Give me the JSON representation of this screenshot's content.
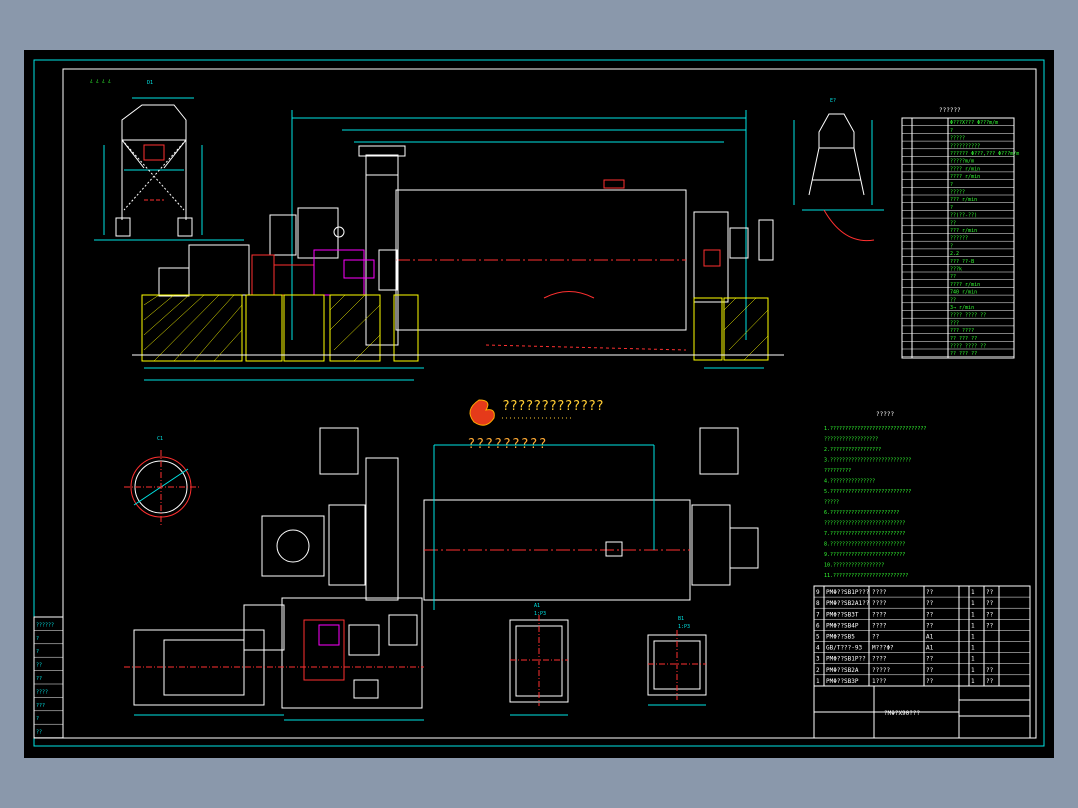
{
  "drawing": {
    "title_block_name": "?MΦ?X90???",
    "corner_marks": "¿ ¿ ¿ ¿",
    "logo_text": "?????????????",
    "watermark_text": "?????????",
    "spec_table_title": "??????",
    "notes_title": "?????",
    "notes_lines": [
      "1.????????????????????????????????",
      "  ??????????????????",
      "2.?????????????????",
      "3.???????????????????????????",
      "  ?????????",
      "4.???????????????",
      "5.???????????????????????????",
      "  ?????",
      "6.???????????????????????",
      "  ???????????????????????????",
      "7.?????????????????????????",
      "8.?????????????????????????",
      "9.?????????????????????????",
      "10.?????????????????",
      "11.?????????????????????????"
    ],
    "view_labels": {
      "d1": "D1",
      "e": "E?",
      "c1": "C1",
      "a1": "A1",
      "b1": "B1",
      "a1_sub": "1:P3",
      "b1_sub": "1:P3"
    },
    "left_strip": [
      "??????",
      "?",
      "?",
      "??",
      "??",
      "????",
      "???",
      "?",
      "??"
    ],
    "parts_rows": [
      [
        "9",
        "PMΦ??SB1P???",
        "????",
        "??",
        "1",
        "??"
      ],
      [
        "8",
        "PMΦ??SB2A1??",
        "????",
        "??",
        "1",
        "??"
      ],
      [
        "7",
        "PMΦ??SB3T",
        "????",
        "??",
        "1",
        "??"
      ],
      [
        "6",
        "PMΦ??SB4P",
        "????",
        "??",
        "1",
        "??"
      ],
      [
        "5",
        "PMΦ??SB5",
        "??",
        "A1",
        "1",
        ""
      ],
      [
        "4",
        "GB/T???-93",
        "M???Φ?",
        "A1",
        "1",
        ""
      ],
      [
        "3",
        "PMΦ??SB1P??",
        "????",
        "??",
        "1",
        ""
      ],
      [
        "2",
        "PMΦ??SB2A",
        "?????",
        "??",
        "1",
        "??"
      ],
      [
        "1",
        "PMΦ??SB3P",
        "1???",
        "??",
        "1",
        "??"
      ]
    ],
    "spec_rows": [
      "Φ???X??? Φ???m/m",
      "?",
      "?????",
      "??????????",
      "?????? Φ???,??? Φ???m/m",
      "?????m/m",
      "???? r/min",
      "???? r/min",
      "?",
      "?????",
      "??? r/min",
      "?",
      "??(??-??)",
      "??",
      "??? r/min",
      "??????",
      "?",
      "2.2",
      "??? ??-B",
      "???k",
      "??",
      "???? r/min",
      "740 r/min",
      "??",
      "3→ r/min",
      "???? ???? ??",
      "???",
      "??? ????",
      "?? ??? ??",
      "???? ???? ??",
      "?? ??? ??"
    ]
  }
}
